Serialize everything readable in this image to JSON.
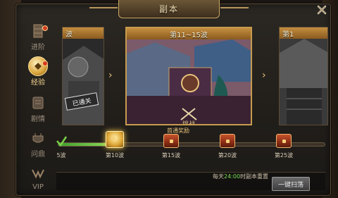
{
  "window": {
    "title": "副本"
  },
  "sidebar": {
    "items": [
      {
        "label": "进阶",
        "icon": "ladder-icon",
        "active": false,
        "badge": "!"
      },
      {
        "label": "经验",
        "icon": "exp-orb-icon",
        "active": true,
        "badge": "!"
      },
      {
        "label": "剧情",
        "icon": "scroll-icon",
        "active": false,
        "badge": ""
      },
      {
        "label": "问鼎",
        "icon": "cauldron-icon",
        "active": false,
        "badge": ""
      },
      {
        "label": "VIP",
        "icon": "vip-icon",
        "active": false,
        "badge": ""
      }
    ]
  },
  "stages": {
    "left_header": "波",
    "left_status": "已通关",
    "center_header": "第11~15波",
    "right_header": "第1",
    "battle_label": "挑战"
  },
  "rewards": {
    "title": "首通奖励",
    "nodes": [
      {
        "label": "5波",
        "state": "claimed"
      },
      {
        "label": "第10波",
        "state": "available"
      },
      {
        "label": "第15波",
        "state": "locked"
      },
      {
        "label": "第20波",
        "state": "locked"
      },
      {
        "label": "第25波",
        "state": "locked"
      }
    ],
    "progress_percent": 20
  },
  "footer": {
    "info_prefix": "每天",
    "info_time": "24:00",
    "info_suffix": "时副本重置",
    "sweep_label": "一键扫荡"
  },
  "colors": {
    "accent_gold": "#c79b4e",
    "progress_green": "#3e9e2e",
    "active_label": "#f2d48e"
  }
}
